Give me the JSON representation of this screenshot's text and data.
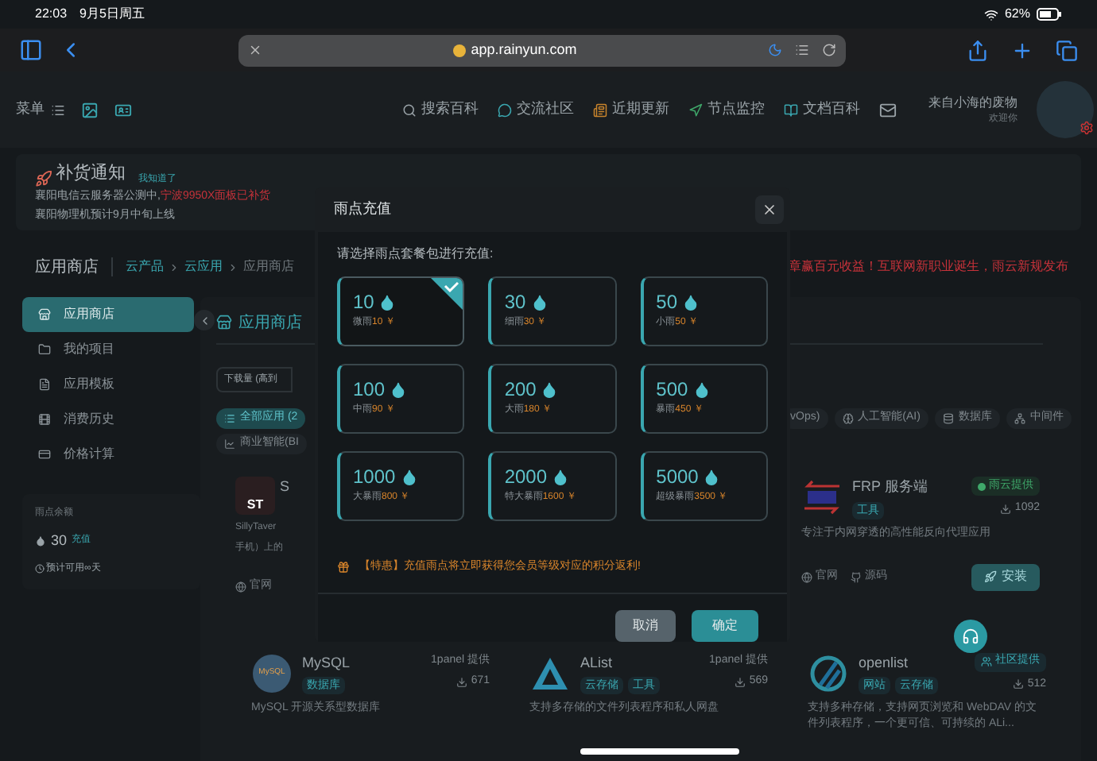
{
  "status_bar": {
    "time": "22:03",
    "date": "9月5日周五",
    "battery": "62%"
  },
  "browser": {
    "url": "app.rainyun.com"
  },
  "header": {
    "menu_label": "菜单",
    "nav": [
      {
        "kind": "search",
        "label": "搜索百科"
      },
      {
        "kind": "community",
        "label": "交流社区"
      },
      {
        "kind": "updates",
        "label": "近期更新"
      },
      {
        "kind": "monitor",
        "label": "节点监控"
      },
      {
        "kind": "docs",
        "label": "文档百科"
      }
    ],
    "user": {
      "name": "来自小海的废物",
      "greeting": "欢迎你"
    }
  },
  "notice": {
    "title": "补货通知",
    "dismiss": "我知道了",
    "line_1": "襄阳电信云服务器公测中,",
    "line_1_highlight": "宁波9950X面板已补货",
    "line_2": "襄阳物理机预计9月中旬上线"
  },
  "breadcrumb": {
    "title": "应用商店",
    "path": [
      "云产品",
      "云应用",
      "应用商店"
    ],
    "announcement": "章赢百元收益！互联网新职业诞生，雨云新规发布"
  },
  "sidebar": {
    "items": [
      {
        "kind": "store",
        "label": "应用商店",
        "selected": true
      },
      {
        "kind": "folder",
        "label": "我的项目",
        "selected": false
      },
      {
        "kind": "template",
        "label": "应用模板",
        "selected": false
      },
      {
        "kind": "history",
        "label": "消费历史",
        "selected": false
      },
      {
        "kind": "price",
        "label": "价格计算",
        "selected": false
      }
    ],
    "balance": {
      "label": "雨点余额",
      "amount": "30",
      "recharge": "充值",
      "estimate": "预计可用∞天"
    }
  },
  "main": {
    "title": "应用商店",
    "sort": "下载量 (高到",
    "categories_left": [
      {
        "kind": "all",
        "label": "全部应用 (2",
        "selected": true
      }
    ],
    "categories_right": [
      {
        "kind": "none",
        "label": "vOps)",
        "selected": false
      },
      {
        "kind": "ai",
        "label": "人工智能(AI)",
        "selected": false
      },
      {
        "kind": "db",
        "label": "数据库",
        "selected": false
      },
      {
        "kind": "middleware",
        "label": "中间件",
        "selected": false
      }
    ],
    "categories_row_2": [
      {
        "kind": "bi",
        "label": "商业智能(BI",
        "selected": false
      }
    ],
    "partial_card": {
      "logo_text": "ST",
      "name": "S",
      "description": [
        "SillyTaver",
        "手机）上的"
      ],
      "website": "官网"
    },
    "top_right_card": {
      "logo": {
        "kind": "frp"
      },
      "name": "FRP 服务端",
      "provider": {
        "label": "雨云提供",
        "kind": "official"
      },
      "tags": [
        "工具"
      ],
      "downloads": "1092",
      "description": "专注于内网穿透的高性能反向代理应用",
      "links": [
        "官网",
        "源码"
      ],
      "install": "安装"
    },
    "bottom_cards": [
      {
        "logo": {
          "kind": "mysql",
          "text": "MySQL"
        },
        "name": "MySQL",
        "provider": {
          "label": "1panel 提供",
          "kind": "plain"
        },
        "tags": [
          "数据库"
        ],
        "downloads": "671",
        "description": "MySQL 开源关系型数据库"
      },
      {
        "logo": {
          "kind": "alist"
        },
        "name": "AList",
        "provider": {
          "label": "1panel 提供",
          "kind": "plain"
        },
        "tags": [
          "云存储",
          "工具"
        ],
        "downloads": "569",
        "description": "支持多存储的文件列表程序和私人网盘"
      },
      {
        "logo": {
          "kind": "openlist"
        },
        "name": "openlist",
        "provider": {
          "label": "社区提供",
          "kind": "community"
        },
        "tags": [
          "网站",
          "云存储"
        ],
        "downloads": "512",
        "description": "支持多种存储，支持网页浏览和 WebDAV 的文件列表程序，一个更可信、可持续的 ALi..."
      }
    ]
  },
  "dialog": {
    "title": "雨点充值",
    "prompt": "请选择雨点套餐包进行充值:",
    "packages": [
      {
        "amount": "10",
        "name": "微雨",
        "price": "10 ￥",
        "selected": true
      },
      {
        "amount": "30",
        "name": "细雨",
        "price": "30 ￥",
        "selected": false
      },
      {
        "amount": "50",
        "name": "小雨",
        "price": "50 ￥",
        "selected": false
      },
      {
        "amount": "100",
        "name": "中雨",
        "price": "90 ￥",
        "selected": false
      },
      {
        "amount": "200",
        "name": "大雨",
        "price": "180 ￥",
        "selected": false
      },
      {
        "amount": "500",
        "name": "暴雨",
        "price": "450 ￥",
        "selected": false
      },
      {
        "amount": "1000",
        "name": "大暴雨",
        "price": "800 ￥",
        "selected": false
      },
      {
        "amount": "2000",
        "name": "特大暴雨",
        "price": "1600 ￥",
        "selected": false
      },
      {
        "amount": "5000",
        "name": "超级暴雨",
        "price": "3500 ￥",
        "selected": false
      }
    ],
    "note": "【特惠】充值雨点将立即获得您会员等级对应的积分返利!",
    "cancel": "取消",
    "confirm": "确定"
  }
}
